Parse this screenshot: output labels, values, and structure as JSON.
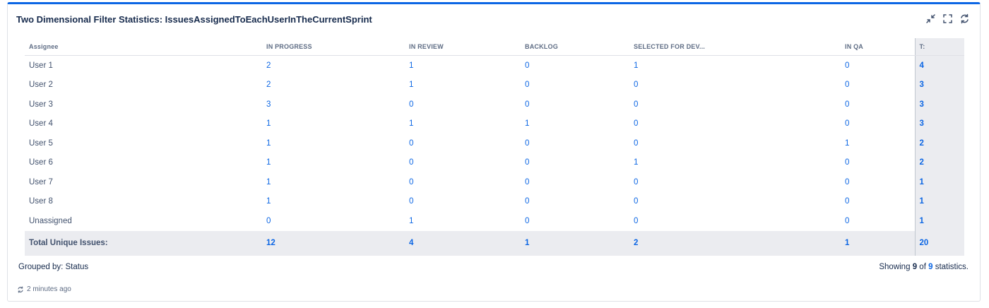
{
  "gadget": {
    "title": "Two Dimensional Filter Statistics: IssuesAssignedToEachUserInTheCurrentSprint",
    "actions": [
      "minimize-icon",
      "fullscreen-icon",
      "refresh-icon"
    ]
  },
  "table": {
    "headers": [
      "Assignee",
      "IN PROGRESS",
      "IN REVIEW",
      "BACKLOG",
      "SELECTED FOR DEV...",
      "IN QA",
      "T:"
    ],
    "rows": [
      {
        "assignee": "User 1",
        "values": [
          "2",
          "1",
          "0",
          "1",
          "0"
        ],
        "total": "4"
      },
      {
        "assignee": "User 2",
        "values": [
          "2",
          "1",
          "0",
          "0",
          "0"
        ],
        "total": "3"
      },
      {
        "assignee": "User 3",
        "values": [
          "3",
          "0",
          "0",
          "0",
          "0"
        ],
        "total": "3"
      },
      {
        "assignee": "User 4",
        "values": [
          "1",
          "1",
          "1",
          "0",
          "0"
        ],
        "total": "3"
      },
      {
        "assignee": "User 5",
        "values": [
          "1",
          "0",
          "0",
          "0",
          "1"
        ],
        "total": "2"
      },
      {
        "assignee": "User 6",
        "values": [
          "1",
          "0",
          "0",
          "1",
          "0"
        ],
        "total": "2"
      },
      {
        "assignee": "User 7",
        "values": [
          "1",
          "0",
          "0",
          "0",
          "0"
        ],
        "total": "1"
      },
      {
        "assignee": "User 8",
        "values": [
          "1",
          "0",
          "0",
          "0",
          "0"
        ],
        "total": "1"
      },
      {
        "assignee": "Unassigned",
        "values": [
          "0",
          "1",
          "0",
          "0",
          "0"
        ],
        "total": "1"
      }
    ],
    "totals": {
      "label": "Total Unique Issues:",
      "values": [
        "12",
        "4",
        "1",
        "2",
        "1"
      ],
      "total": "20"
    }
  },
  "footer": {
    "grouped_by": "Grouped by: Status",
    "showing_prefix": "Showing",
    "showing_count": "9",
    "showing_of": "of",
    "showing_total": "9",
    "showing_suffix": "statistics.",
    "updated": "2 minutes ago"
  },
  "colors": {
    "accent": "#0c66e4",
    "total_bg": "#ebecf0"
  }
}
